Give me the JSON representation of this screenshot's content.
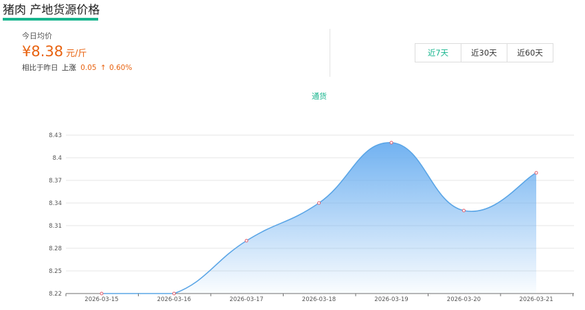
{
  "header": {
    "title": "猪肉 产地货源价格"
  },
  "price": {
    "today_label": "今日均价",
    "value": "¥8.38",
    "unit": "元/斤",
    "compare_label": "相比于昨日",
    "direction": "上涨",
    "change": "0.05",
    "arrow": "↑",
    "percent": "0.60%"
  },
  "range_tabs": [
    {
      "label": "近7天",
      "active": true
    },
    {
      "label": "近30天",
      "active": false
    },
    {
      "label": "近60天",
      "active": false
    }
  ],
  "colors": {
    "accent": "#17b58e",
    "price": "#e8620f",
    "line": "#5aa5e6",
    "area_top": "#6aaef0",
    "marker": "#e05a6a"
  },
  "chart_data": {
    "type": "area",
    "legend": "通货",
    "x": [
      "2026-03-15",
      "2026-03-16",
      "2026-03-17",
      "2026-03-18",
      "2026-03-19",
      "2026-03-20",
      "2026-03-21"
    ],
    "series": [
      {
        "name": "通货",
        "values": [
          8.22,
          8.22,
          8.29,
          8.34,
          8.42,
          8.33,
          8.38
        ]
      }
    ],
    "yticks": [
      "8.22",
      "8.25",
      "8.28",
      "8.31",
      "8.34",
      "8.37",
      "8.4",
      "8.43"
    ],
    "ylim": [
      8.22,
      8.43
    ],
    "grid": true,
    "smooth": true
  }
}
